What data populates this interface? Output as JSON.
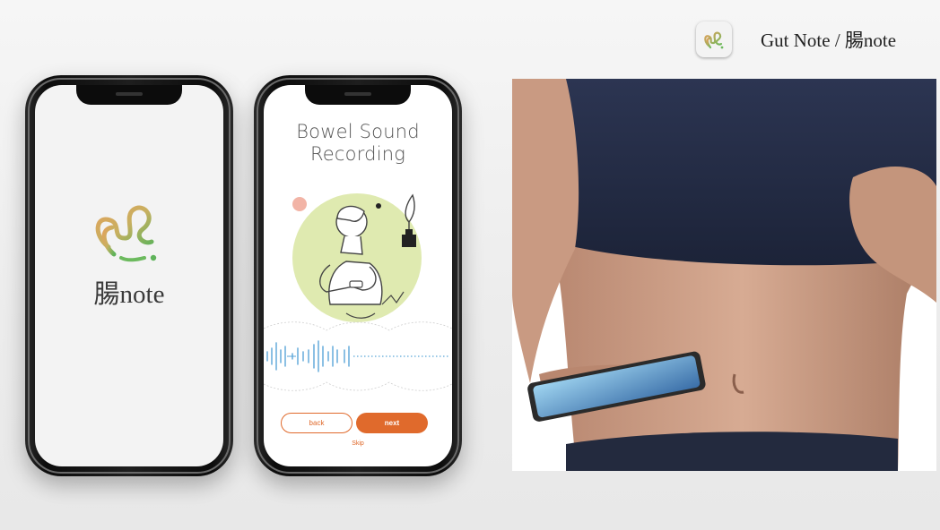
{
  "brand": {
    "text": "Gut Note / 腸note",
    "logo_icon": "gut-note-logo-icon"
  },
  "phone_splash": {
    "app_name": "腸note"
  },
  "phone_recording": {
    "title_line1": "Bowel Sound",
    "title_line2": "Recording",
    "back_label": "back",
    "next_label": "next",
    "skip_label": "Skip"
  },
  "colors": {
    "accent": "#e06a2c",
    "illustration_green": "#dfeab0",
    "wave_blue": "#5aa6d8"
  }
}
